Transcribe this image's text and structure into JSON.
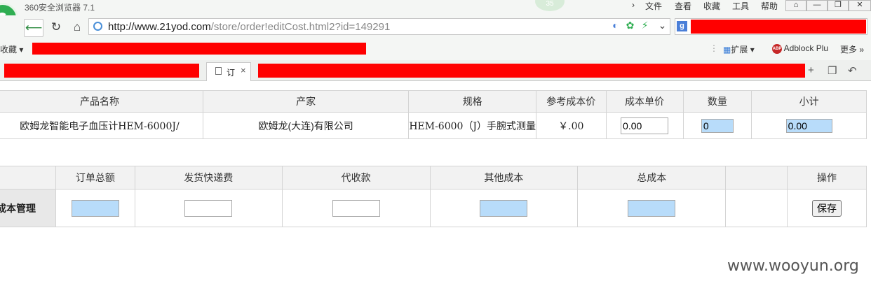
{
  "browser": {
    "title": "360安全浏览器 7.1",
    "badge": "35",
    "menu": [
      "文件",
      "查看",
      "收藏",
      "工具",
      "帮助"
    ],
    "window_buttons": [
      "⌂",
      "—",
      "❐",
      "✕"
    ],
    "url_host": "http://www.21yod.com",
    "url_path": "/store/order!editCost.html2?id=149291",
    "search_engine_icon": "g",
    "favorites_label": "收藏",
    "ext_label": "扩展",
    "adblock_label": "Adblock Plu",
    "more_label": "更多 »",
    "active_tab_label": "订",
    "tab_close": "×"
  },
  "products_table": {
    "headers": [
      "产品名称",
      "产家",
      "规格",
      "参考成本价",
      "成本单价",
      "数量",
      "小计"
    ],
    "row": {
      "name": "欧姆龙智能电子血压计HEM-6000J/",
      "maker": "欧姆龙(大连)有限公司",
      "spec": "HEM-6000（J）手腕式测量",
      "ref_cost": "￥.00",
      "unit_cost": "0.00",
      "quantity": "0",
      "subtotal": "0.00"
    }
  },
  "cost_table": {
    "headers": [
      "",
      "订单总额",
      "发货快递费",
      "代收款",
      "其他成本",
      "总成本",
      "",
      "操作"
    ],
    "row_label": "成本管理",
    "order_total": "",
    "shipping_fee": "",
    "cod": "",
    "other_cost": "",
    "total_cost": "",
    "save_label": "保存"
  },
  "watermark": "www.wooyun.org",
  "colors": {
    "redaction": "#ff0000",
    "input_highlight": "#b8dcfa",
    "logo_green": "#2fae52"
  }
}
